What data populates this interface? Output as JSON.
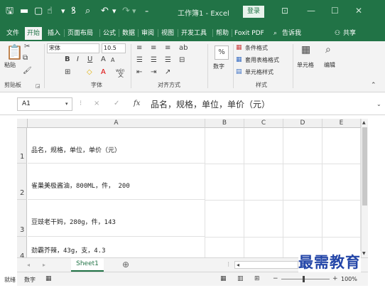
{
  "window": {
    "title": "工作簿1 - Excel",
    "login_label": "登录",
    "qat_icons": [
      "save-icon",
      "open-icon",
      "new-icon",
      "touch-mode-icon",
      "spellcheck-icon",
      "print-preview-icon",
      "undo-icon",
      "redo-icon",
      "customize-icon"
    ]
  },
  "tabs": [
    "文件",
    "开始",
    "插入",
    "页面布局",
    "公式",
    "数据",
    "审阅",
    "视图",
    "开发工具",
    "帮助",
    "Foxit PDF",
    "告诉我",
    "共享"
  ],
  "active_tab": "开始",
  "ribbon": {
    "clipboard": {
      "paste": "粘贴",
      "label": "剪贴板"
    },
    "font": {
      "name": "宋体",
      "size": "10.5",
      "bold": "B",
      "italic": "I",
      "underline": "U",
      "grow": "A",
      "shrink": "A",
      "label": "字体",
      "wen": "wén",
      "wen_char": "文"
    },
    "alignment": {
      "label": "对齐方式"
    },
    "number": {
      "percent": "%",
      "label": "数字"
    },
    "styles": {
      "conditional": "条件格式",
      "table": "套用表格格式",
      "cell_styles": "单元格样式",
      "label": "样式"
    },
    "cells": {
      "label": "单元格"
    },
    "editing": {
      "label": "编辑"
    }
  },
  "formula_bar": {
    "name_box": "A1",
    "cancel": "×",
    "enter": "✓",
    "fx": "fx",
    "content": "品名，规格，单位，单价（元）"
  },
  "columns": [
    "A",
    "B",
    "C",
    "D",
    "E"
  ],
  "rows": [
    {
      "num": "1",
      "a": "品名，规格，单位，单价（元）"
    },
    {
      "num": "2",
      "a": "雀巢美极酱油，800ML，件， 200"
    },
    {
      "num": "3",
      "a": "豆豉老干妈，280g，件，143"
    },
    {
      "num": "4",
      "a": "劲霸芥辣，43g，支，4.3"
    }
  ],
  "sheet_tabs": {
    "active": "Sheet1",
    "add": "⊕"
  },
  "status_bar": {
    "ready": "就绪",
    "numlock": "数字",
    "zoom": "100%"
  },
  "watermark": "最需教育"
}
